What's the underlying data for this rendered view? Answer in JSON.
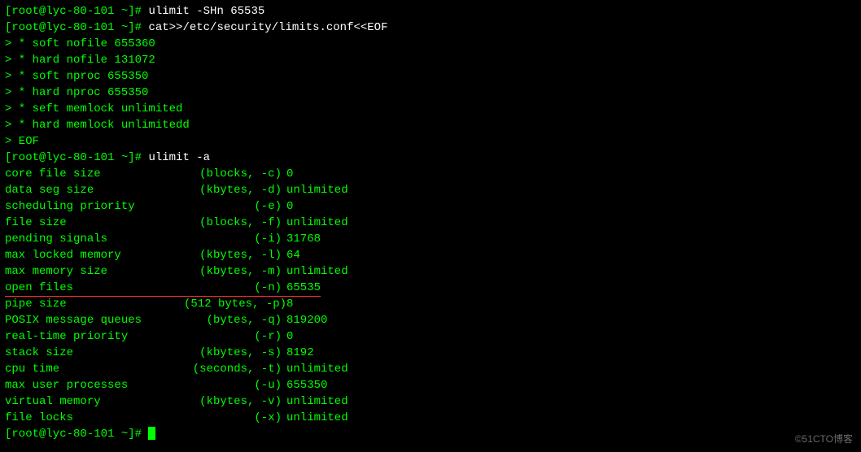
{
  "prompt": "[root@lyc-80-101 ~]# ",
  "heredoc_prompt": "> ",
  "commands": {
    "cmd1": "ulimit -SHn 65535",
    "cmd2": "cat>>/etc/security/limits.conf<<EOF",
    "cmd3": "ulimit -a",
    "cmd4": ""
  },
  "heredoc_lines": [
    "* soft nofile 655360",
    "* hard nofile 131072",
    "* soft nproc 655350",
    "* hard nproc 655350",
    "* seft memlock unlimited",
    "* hard memlock unlimitedd",
    "EOF"
  ],
  "ulimit_rows": [
    {
      "label": "core file size",
      "spec": "(blocks, -c)",
      "val": "0",
      "highlight": false
    },
    {
      "label": "data seg size",
      "spec": "(kbytes, -d)",
      "val": "unlimited",
      "highlight": false
    },
    {
      "label": "scheduling priority",
      "spec": "(-e)",
      "val": "0",
      "highlight": false
    },
    {
      "label": "file size",
      "spec": "(blocks, -f)",
      "val": "unlimited",
      "highlight": false
    },
    {
      "label": "pending signals",
      "spec": "(-i)",
      "val": "31768",
      "highlight": false
    },
    {
      "label": "max locked memory",
      "spec": "(kbytes, -l)",
      "val": "64",
      "highlight": false
    },
    {
      "label": "max memory size",
      "spec": "(kbytes, -m)",
      "val": "unlimited",
      "highlight": false
    },
    {
      "label": "open files",
      "spec": "(-n)",
      "val": "65535",
      "highlight": true
    },
    {
      "label": "pipe size",
      "spec": "(512 bytes, -p)",
      "val": "8",
      "highlight": false
    },
    {
      "label": "POSIX message queues",
      "spec": "(bytes, -q)",
      "val": "819200",
      "highlight": false
    },
    {
      "label": "real-time priority",
      "spec": "(-r)",
      "val": "0",
      "highlight": false
    },
    {
      "label": "stack size",
      "spec": "(kbytes, -s)",
      "val": "8192",
      "highlight": false
    },
    {
      "label": "cpu time",
      "spec": "(seconds, -t)",
      "val": "unlimited",
      "highlight": false
    },
    {
      "label": "max user processes",
      "spec": "(-u)",
      "val": "655350",
      "highlight": false
    },
    {
      "label": "virtual memory",
      "spec": "(kbytes, -v)",
      "val": "unlimited",
      "highlight": false
    },
    {
      "label": "file locks",
      "spec": "(-x)",
      "val": "unlimited",
      "highlight": false
    }
  ],
  "watermark": "©51CTO博客"
}
